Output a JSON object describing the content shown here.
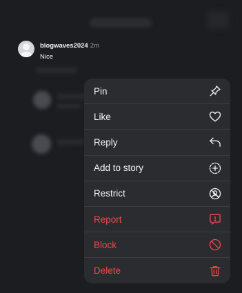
{
  "comment": {
    "username": "blogwaves2024",
    "time": "2m",
    "text": "Nice"
  },
  "menu": {
    "items": [
      {
        "label": "Pin",
        "icon": "pin-icon",
        "danger": false
      },
      {
        "label": "Like",
        "icon": "heart-icon",
        "danger": false
      },
      {
        "label": "Reply",
        "icon": "reply-arrow-icon",
        "danger": false
      },
      {
        "label": "Add to story",
        "icon": "add-circle-icon",
        "danger": false
      },
      {
        "label": "Restrict",
        "icon": "restrict-icon",
        "danger": false
      },
      {
        "label": "Report",
        "icon": "report-icon",
        "danger": true
      },
      {
        "label": "Block",
        "icon": "block-icon",
        "danger": true
      },
      {
        "label": "Delete",
        "icon": "trash-icon",
        "danger": true
      }
    ]
  },
  "colors": {
    "background": "#1c1d21",
    "menu_background": "#2b2c30",
    "danger": "#ef4a49",
    "text": "#f4f4f5"
  }
}
